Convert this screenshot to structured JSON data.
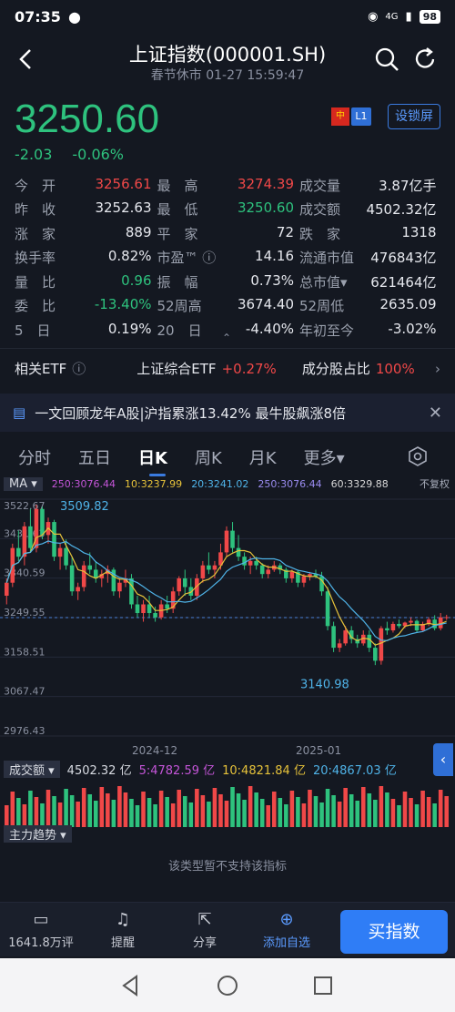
{
  "status": {
    "time": "07:35",
    "battery": "98",
    "network": "4G"
  },
  "header": {
    "title": "上证指数(000001.SH)",
    "subtitle": "春节休市 01-27 15:59:47"
  },
  "quote": {
    "price": "3250.60",
    "change": "-2.03",
    "change_pct": "-0.06%",
    "flag_label": "中",
    "level_badge": "L1",
    "lock_button": "设锁屏"
  },
  "stats": [
    [
      {
        "label": "今　开",
        "value": "3256.61",
        "color": "red"
      },
      {
        "label": "最　高",
        "value": "3274.39",
        "color": "red"
      },
      {
        "label": "成交量",
        "value": "3.87亿手",
        "color": "white"
      }
    ],
    [
      {
        "label": "昨　收",
        "value": "3252.63",
        "color": "white"
      },
      {
        "label": "最　低",
        "value": "3250.60",
        "color": "green"
      },
      {
        "label": "成交额",
        "value": "4502.32亿",
        "color": "white"
      }
    ],
    [
      {
        "label": "涨　家",
        "value": "889",
        "color": "white"
      },
      {
        "label": "平　家",
        "value": "72",
        "color": "white"
      },
      {
        "label": "跌　家",
        "value": "1318",
        "color": "white"
      }
    ],
    [
      {
        "label": "换手率",
        "value": "0.82%",
        "color": "white"
      },
      {
        "label": "市盈™ ⓘ",
        "value": "14.16",
        "color": "white"
      },
      {
        "label": "流通市值",
        "value": "476843亿",
        "color": "white"
      }
    ],
    [
      {
        "label": "量　比",
        "value": "0.96",
        "color": "green"
      },
      {
        "label": "振　幅",
        "value": "0.73%",
        "color": "white"
      },
      {
        "label": "总市值▾",
        "value": "621464亿",
        "color": "white"
      }
    ],
    [
      {
        "label": "委　比",
        "value": "-13.40%",
        "color": "green"
      },
      {
        "label": "52周高",
        "value": "3674.40",
        "color": "white"
      },
      {
        "label": "52周低",
        "value": "2635.09",
        "color": "white"
      }
    ],
    [
      {
        "label": "5　日",
        "value": "0.19%",
        "color": "white"
      },
      {
        "label": "20　日",
        "value": "-4.40%",
        "color": "white"
      },
      {
        "label": "年初至今",
        "value": "-3.02%",
        "color": "white"
      }
    ]
  ],
  "etf": {
    "label": "相关ETF",
    "etf_name": "上证综合ETF",
    "etf_change": "+0.27%",
    "ratio_label": "成分股占比",
    "ratio_value": "100%"
  },
  "news": {
    "text": "一文回顾龙年A股|沪指累涨13.42% 最牛股飙涨8倍"
  },
  "tabs": [
    "分时",
    "五日",
    "日K",
    "周K",
    "月K",
    "更多▾"
  ],
  "active_tab": 2,
  "ma_legend": {
    "button": "MA ▾",
    "ma250a": "250:3076.44",
    "ma10": "10:3237.99",
    "ma20": "20:3241.02",
    "ma250b": "250:3076.44",
    "ma60": "60:3329.88",
    "adjust": "不复权"
  },
  "chart_data": {
    "type": "candlestick",
    "y_ticks": [
      "3522.67",
      "3431.63",
      "3340.59",
      "3249.55",
      "3158.51",
      "3067.47",
      "2976.43"
    ],
    "ylim": [
      2976.43,
      3522.67
    ],
    "x_labels": [
      "2024-12",
      "2025-01"
    ],
    "annotations": {
      "high": "3509.82",
      "low": "3140.98",
      "last_line": 3249.55
    },
    "candles": [
      [
        3300,
        3340,
        3280,
        3330
      ],
      [
        3330,
        3420,
        3320,
        3410
      ],
      [
        3410,
        3450,
        3380,
        3390
      ],
      [
        3390,
        3470,
        3370,
        3460
      ],
      [
        3460,
        3500,
        3400,
        3410
      ],
      [
        3410,
        3510,
        3400,
        3500
      ],
      [
        3500,
        3505,
        3430,
        3440
      ],
      [
        3440,
        3480,
        3420,
        3470
      ],
      [
        3470,
        3475,
        3380,
        3390
      ],
      [
        3390,
        3420,
        3360,
        3410
      ],
      [
        3410,
        3430,
        3360,
        3370
      ],
      [
        3370,
        3390,
        3300,
        3310
      ],
      [
        3310,
        3330,
        3290,
        3320
      ],
      [
        3320,
        3380,
        3310,
        3370
      ],
      [
        3370,
        3400,
        3350,
        3360
      ],
      [
        3360,
        3380,
        3330,
        3340
      ],
      [
        3340,
        3360,
        3320,
        3350
      ],
      [
        3350,
        3370,
        3330,
        3360
      ],
      [
        3360,
        3365,
        3300,
        3310
      ],
      [
        3310,
        3340,
        3295,
        3330
      ],
      [
        3330,
        3360,
        3320,
        3340
      ],
      [
        3340,
        3350,
        3270,
        3280
      ],
      [
        3280,
        3300,
        3250,
        3260
      ],
      [
        3260,
        3290,
        3240,
        3280
      ],
      [
        3280,
        3300,
        3250,
        3260
      ],
      [
        3260,
        3275,
        3240,
        3250
      ],
      [
        3250,
        3290,
        3245,
        3280
      ],
      [
        3280,
        3300,
        3260,
        3270
      ],
      [
        3270,
        3320,
        3260,
        3310
      ],
      [
        3310,
        3345,
        3300,
        3340
      ],
      [
        3340,
        3360,
        3300,
        3320
      ],
      [
        3320,
        3340,
        3290,
        3300
      ],
      [
        3300,
        3350,
        3290,
        3340
      ],
      [
        3340,
        3380,
        3330,
        3370
      ],
      [
        3370,
        3400,
        3350,
        3360
      ],
      [
        3360,
        3380,
        3340,
        3370
      ],
      [
        3370,
        3420,
        3360,
        3400
      ],
      [
        3400,
        3460,
        3390,
        3450
      ],
      [
        3450,
        3470,
        3400,
        3410
      ],
      [
        3410,
        3440,
        3380,
        3390
      ],
      [
        3390,
        3400,
        3360,
        3370
      ],
      [
        3370,
        3390,
        3350,
        3380
      ],
      [
        3380,
        3390,
        3360,
        3370
      ],
      [
        3370,
        3375,
        3340,
        3350
      ],
      [
        3350,
        3370,
        3340,
        3360
      ],
      [
        3360,
        3380,
        3355,
        3370
      ],
      [
        3370,
        3375,
        3350,
        3360
      ],
      [
        3360,
        3365,
        3330,
        3340
      ],
      [
        3340,
        3360,
        3330,
        3355
      ],
      [
        3355,
        3360,
        3320,
        3330
      ],
      [
        3330,
        3350,
        3320,
        3345
      ],
      [
        3345,
        3355,
        3335,
        3350
      ],
      [
        3350,
        3360,
        3340,
        3345
      ],
      [
        3345,
        3355,
        3300,
        3310
      ],
      [
        3310,
        3320,
        3220,
        3230
      ],
      [
        3230,
        3240,
        3170,
        3180
      ],
      [
        3180,
        3200,
        3170,
        3190
      ],
      [
        3190,
        3230,
        3185,
        3220
      ],
      [
        3220,
        3230,
        3190,
        3200
      ],
      [
        3200,
        3210,
        3180,
        3190
      ],
      [
        3190,
        3220,
        3185,
        3210
      ],
      [
        3210,
        3220,
        3170,
        3180
      ],
      [
        3180,
        3190,
        3140,
        3150
      ],
      [
        3150,
        3230,
        3141,
        3225
      ],
      [
        3225,
        3240,
        3210,
        3220
      ],
      [
        3220,
        3240,
        3215,
        3235
      ],
      [
        3235,
        3245,
        3225,
        3230
      ],
      [
        3230,
        3240,
        3225,
        3238
      ],
      [
        3238,
        3250,
        3230,
        3242
      ],
      [
        3242,
        3245,
        3215,
        3220
      ],
      [
        3220,
        3240,
        3218,
        3235
      ],
      [
        3235,
        3250,
        3230,
        3245
      ],
      [
        3245,
        3255,
        3220,
        3225
      ],
      [
        3225,
        3260,
        3220,
        3250
      ],
      [
        3250,
        3256,
        3244,
        3250.6
      ]
    ]
  },
  "volume": {
    "button": "成交额 ▾",
    "value": "4502.32 亿",
    "ma5": "5:4782.59 亿",
    "ma10": "10:4821.84 亿",
    "ma20": "20:4867.03 亿"
  },
  "flow": {
    "button": "主力趋势 ▾",
    "unsupported": "该类型暂不支持该指标"
  },
  "bottom": {
    "comments": "1641.8万评",
    "remind": "提醒",
    "share": "分享",
    "add": "添加自选",
    "buy": "买指数"
  },
  "colors": {
    "up": "#f04848",
    "down": "#2ec27e",
    "accent": "#2f7df6"
  }
}
